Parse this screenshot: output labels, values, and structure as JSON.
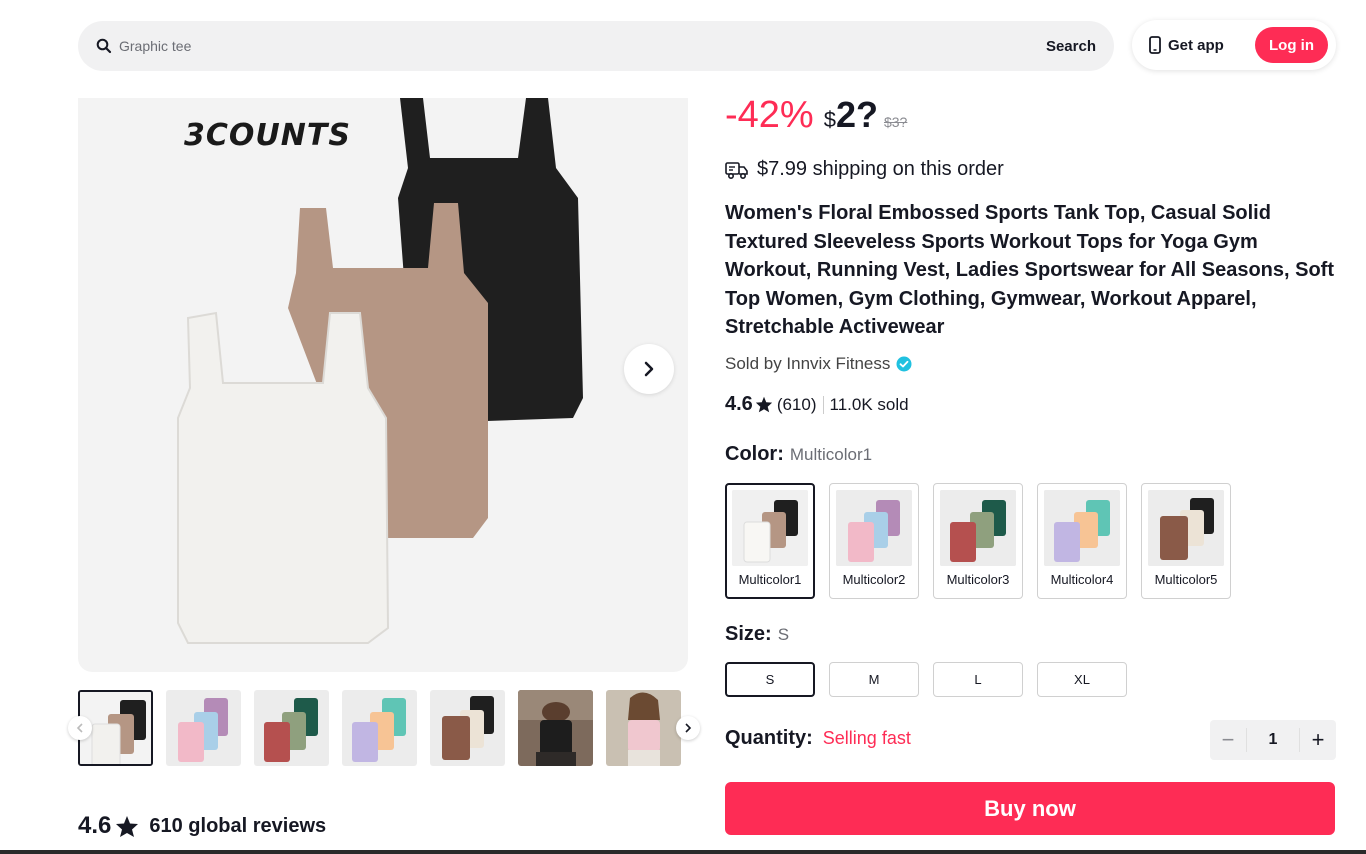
{
  "header": {
    "search_placeholder": "Graphic tee",
    "search_button": "Search",
    "get_app": "Get app",
    "login": "Log in",
    "accent": "#fe2c55"
  },
  "gallery": {
    "brand_text": "3COUNTS",
    "thumbnail_count": 7,
    "active_thumbnail": 1
  },
  "product": {
    "discount": "-42%",
    "currency": "$",
    "price": "2?",
    "old_price": "$3?",
    "shipping": "$7.99 shipping on this order",
    "title": "Women's Floral Embossed Sports Tank Top, Casual Solid Textured Sleeveless Sports Workout Tops for Yoga Gym Workout, Running Vest, Ladies Sportswear for All Seasons, Soft Top Women, Gym Clothing, Gymwear, Workout Apparel, Stretchable Activewear",
    "seller": "Sold by Innvix Fitness",
    "rating": "4.6",
    "review_count": "(610)",
    "sold": "11.0K sold"
  },
  "options": {
    "color_label": "Color:",
    "color_selected": "Multicolor1",
    "colors": [
      "Multicolor1",
      "Multicolor2",
      "Multicolor3",
      "Multicolor4",
      "Multicolor5"
    ],
    "size_label": "Size:",
    "size_selected": "S",
    "sizes": [
      "S",
      "M",
      "L",
      "XL"
    ]
  },
  "quantity": {
    "label": "Quantity:",
    "status": "Selling fast",
    "value": "1",
    "minus": "−",
    "plus": "+"
  },
  "buy_now": "Buy now",
  "reviews": {
    "rating": "4.6",
    "count_text": "610 global reviews"
  }
}
